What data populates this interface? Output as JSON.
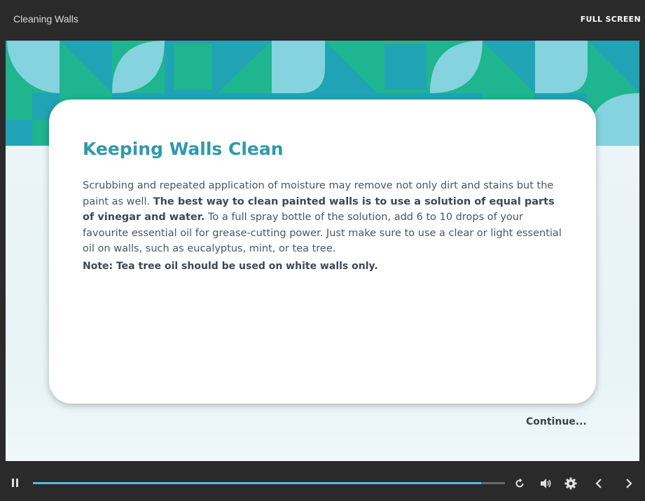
{
  "header": {
    "title": "Cleaning Walls",
    "fullscreen_label": "FULL SCREEN"
  },
  "slide": {
    "title": "Keeping Walls Clean",
    "body_part1": "Scrubbing and repeated application of moisture may remove not only dirt and stains but the paint as well. ",
    "body_bold": "The best way to clean painted walls is to use a solution of equal parts of vinegar and water.",
    "body_part2": " To a full spray bottle of the solution, add 6 to 10 drops of your favourite essential oil for grease-cutting power. Just make sure to use a clear or light essential oil on walls, such as eucalyptus, mint, or tea tree.",
    "note": "Note: Tea tree oil should be used on white walls only.",
    "continue_label": "Continue..."
  },
  "player": {
    "progress": 0.95,
    "icons": [
      "pause-icon",
      "replay-icon",
      "volume-icon",
      "settings-icon",
      "previous-icon",
      "next-icon"
    ]
  },
  "colors": {
    "accent": "#2f9aaa",
    "progress": "#5ab8e8",
    "banner_green": "#1fb58f",
    "banner_blue": "#1fa3b5",
    "banner_light": "#85d3de"
  }
}
